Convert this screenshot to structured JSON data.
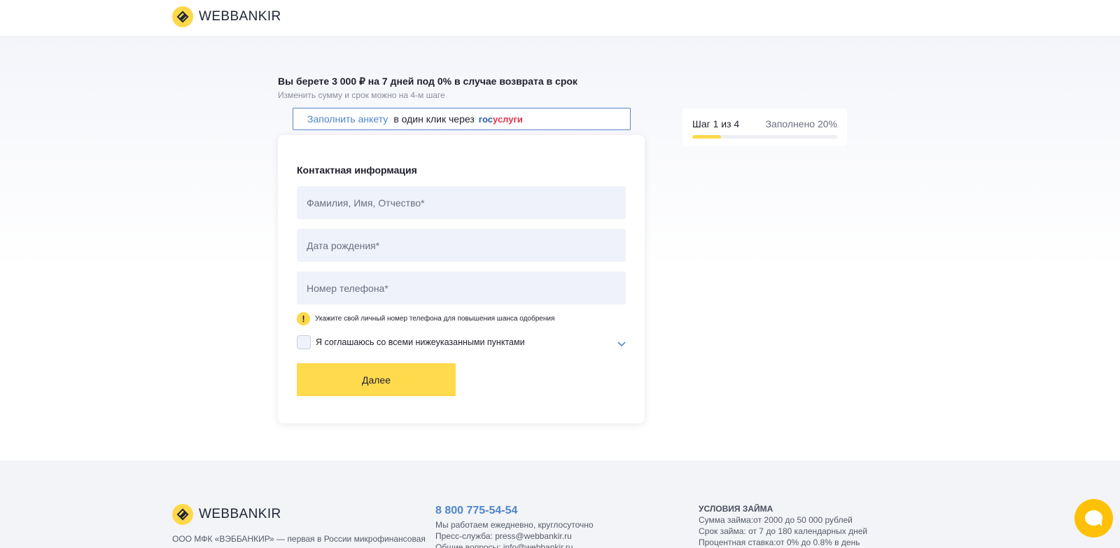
{
  "header": {
    "brand": "WEBBANKIR"
  },
  "offer": {
    "title": "Вы берете 3 000 ₽ на 7 дней под 0% в случае возврата в срок",
    "subtitle": "Изменить сумму и срок можно на 4-м шаге"
  },
  "gosuslugi": {
    "link": "Заполнить анкету",
    "text": "в один клик через",
    "brand_part1": "гос",
    "brand_part2": "услуги"
  },
  "form": {
    "title": "Контактная информация",
    "fio_placeholder": "Фамилия, Имя, Отчество*",
    "birthdate_placeholder": "Дата рождения*",
    "phone_placeholder": "Номер телефона*",
    "hint": "Укажите свой личный номер телефона для повышения шанса одобрения",
    "agree_label": "Я соглашаюсь со всеми нижеуказанными пунктами",
    "next_button": "Далее"
  },
  "steps": {
    "step_text": "Шаг 1 из 4",
    "filled_text": "Заполнено 20%",
    "progress": 0.2
  },
  "footer": {
    "brand": "WEBBANKIR",
    "about": "ООО МФК «ВЭББАНКИР» — первая в России микрофинансовая",
    "phone": "8 800 775-54-54",
    "contact_lines": [
      "Мы работаем ежедневно, круглосуточно",
      "Пресс-служба: press@webbankir.ru",
      "Общие вопросы: info@webbankir.ru"
    ],
    "terms_title": "УСЛОВИЯ ЗАЙМА",
    "terms_lines": [
      "Сумма займа:от 2000 до 50 000 рублей",
      "Срок займа: от 7 до 180 календарных дней",
      "Процентная ставка:от 0% до 0.8% в день"
    ]
  },
  "colors": {
    "accent_yellow": "#ffd84a",
    "link_blue": "#4f86c9",
    "field_bg": "#eff2fb"
  },
  "icons": [
    "logo-icon",
    "warning-icon",
    "chevron-down-icon",
    "chat-icon"
  ]
}
